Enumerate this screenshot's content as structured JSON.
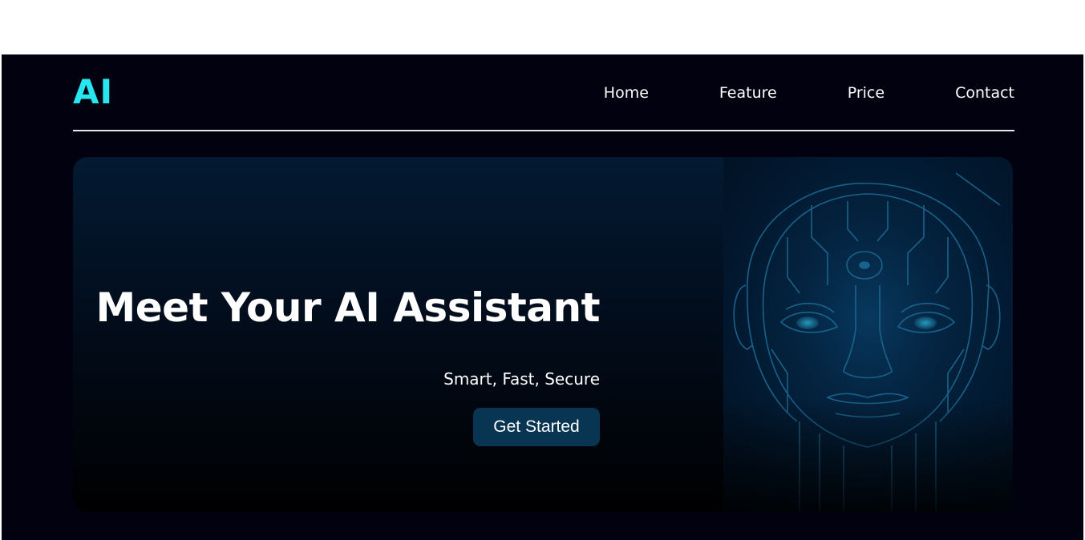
{
  "header": {
    "logo": "AI",
    "nav": [
      {
        "label": "Home"
      },
      {
        "label": "Feature"
      },
      {
        "label": "Price"
      },
      {
        "label": "Contact"
      }
    ]
  },
  "hero": {
    "title": "Meet Your AI Assistant",
    "subtitle": "Smart, Fast, Secure",
    "cta_label": "Get Started",
    "image": "robot-face-illustration"
  },
  "colors": {
    "page_background": "#02010f",
    "logo": "#28e6f0",
    "button": "#073552",
    "text": "#ffffff"
  }
}
